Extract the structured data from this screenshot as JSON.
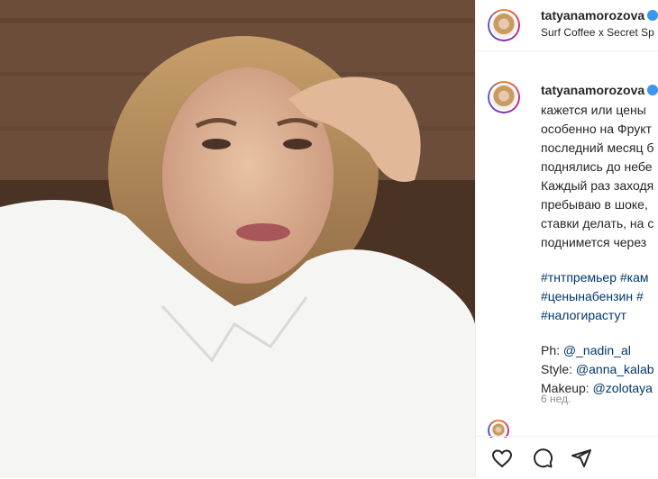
{
  "post": {
    "author": {
      "username": "tatyanamorozova",
      "location": "Surf Coffee x Secret Sp",
      "verified": true
    },
    "comment": {
      "username": "tatyanamorozova",
      "lines": [
        "кажется или цены",
        "особенно на Фрукт",
        "последний месяц б",
        "поднялись до небе",
        "Каждый раз заходя",
        "пребываю в шоке,",
        "ставки делать, на с",
        "поднимется через"
      ],
      "hashtags": [
        "#тнтпремьер #кам",
        "#ценынабензин #",
        "#налогирастут"
      ],
      "credits": [
        {
          "label": "Ph: ",
          "mention": "@_nadin_al"
        },
        {
          "label": "Style: ",
          "mention": "@anna_kalab"
        },
        {
          "label": "Makeup: ",
          "mention": "@zolotaya"
        }
      ],
      "time": "6 нед."
    }
  },
  "icons": {
    "like": "heart-icon",
    "comment": "comment-icon",
    "share": "share-icon"
  },
  "colors": {
    "link": "#00376b",
    "muted": "#8e8e8e",
    "verified": "#3897f0"
  }
}
